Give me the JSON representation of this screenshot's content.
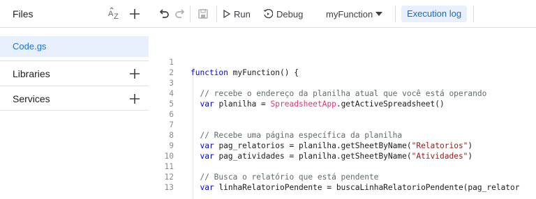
{
  "sidebar": {
    "files_title": "Files",
    "files": [
      {
        "name": "Code.gs",
        "selected": true
      }
    ],
    "sections": [
      {
        "label": "Libraries"
      },
      {
        "label": "Services"
      }
    ]
  },
  "toolbar": {
    "run_label": "Run",
    "debug_label": "Debug",
    "function_name": "myFunction",
    "execution_log_label": "Execution log"
  },
  "editor": {
    "lines": [
      {
        "num": "1",
        "text": "function myFunction() {"
      },
      {
        "num": "2",
        "text": ""
      },
      {
        "num": "3",
        "text": "  // recebe o endereço da planilha atual que você está operando"
      },
      {
        "num": "4",
        "text": "  var planilha = SpreadsheetApp.getActiveSpreadsheet()"
      },
      {
        "num": "5",
        "text": ""
      },
      {
        "num": "6",
        "text": ""
      },
      {
        "num": "7",
        "text": "  // Recebe uma página específica da planilha"
      },
      {
        "num": "8",
        "text": "  var pag_relatorios = planilha.getSheetByName(\"Relatorios\")"
      },
      {
        "num": "9",
        "text": "  var pag_atividades = planilha.getSheetByName(\"Atividades\")"
      },
      {
        "num": "10",
        "text": ""
      },
      {
        "num": "11",
        "text": "  // Busca o relatório que está pendente"
      },
      {
        "num": "12",
        "text": "  var linhaRelatorioPendente = buscaLinhaRelatorioPendente(pag_relator"
      },
      {
        "num": "13",
        "text": ""
      }
    ]
  },
  "colors": {
    "accent": "#1a73e8",
    "selected_bg": "#e8f0fe",
    "keyword": "#0000ff",
    "string": "#a31515",
    "class_name": "#e8336b",
    "comment": "#5f6a6a"
  }
}
